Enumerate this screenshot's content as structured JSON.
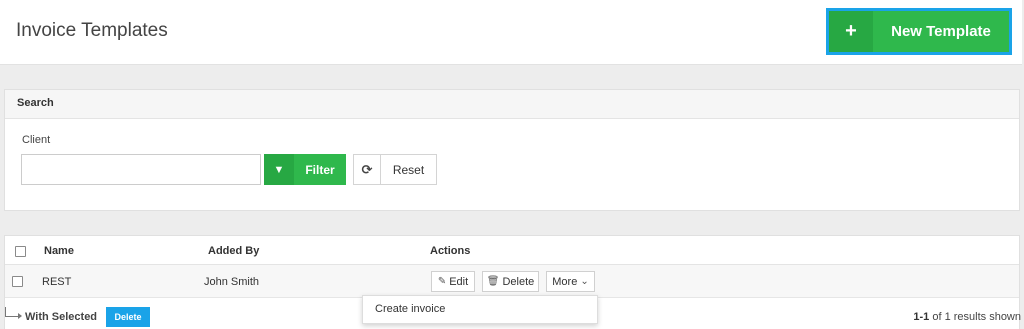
{
  "header": {
    "title": "Invoice Templates",
    "new_button": {
      "icon": "plus-icon",
      "label": "New Template"
    }
  },
  "search": {
    "title": "Search",
    "client_label": "Client",
    "client_value": "",
    "filter_label": "Filter",
    "reset_label": "Reset"
  },
  "table": {
    "columns": {
      "name": "Name",
      "added_by": "Added By",
      "actions": "Actions"
    },
    "rows": [
      {
        "name": "REST",
        "added_by": "John Smith"
      }
    ],
    "row_actions": {
      "edit": "Edit",
      "delete": "Delete",
      "more": "More"
    }
  },
  "more_menu": {
    "items": [
      "Create invoice"
    ]
  },
  "footer": {
    "with_selected": "With Selected",
    "delete_label": "Delete",
    "range": "1-1",
    "results_text": " of 1 results shown"
  },
  "colors": {
    "accent_green": "#2fb84c",
    "accent_blue": "#1aa3e8"
  }
}
